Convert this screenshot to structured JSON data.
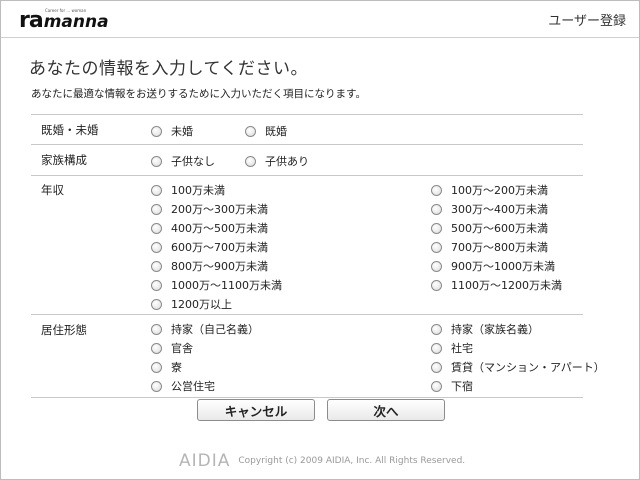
{
  "header": {
    "logo_main": "ra",
    "logo_sub": "manna",
    "logo_tagline": "Career for ... woman",
    "page_title": "ユーザー登録"
  },
  "main": {
    "heading": "あなたの情報を入力してください。",
    "subtext": "あなたに最適な情報をお送りするために入力いただく項目になります。"
  },
  "form": {
    "marital": {
      "label": "既婚・未婚",
      "options": [
        "未婚",
        "既婚"
      ]
    },
    "family": {
      "label": "家族構成",
      "options": [
        "子供なし",
        "子供あり"
      ]
    },
    "income": {
      "label": "年収",
      "left": [
        "100万未満",
        "200万～300万未満",
        "400万～500万未満",
        "600万～700万未満",
        "800万～900万未満",
        "1000万～1100万未満",
        "1200万以上"
      ],
      "right": [
        "100万～200万未満",
        "300万～400万未満",
        "500万～600万未満",
        "700万～800万未満",
        "900万～1000万未満",
        "1100万～1200万未満"
      ]
    },
    "residence": {
      "label": "居住形態",
      "left": [
        "持家（自己名義）",
        "官舎",
        "寮",
        "公営住宅"
      ],
      "right": [
        "持家（家族名義）",
        "社宅",
        "賃貸（マンション・アパート）",
        "下宿"
      ]
    }
  },
  "buttons": {
    "cancel": "キャンセル",
    "next": "次へ"
  },
  "footer": {
    "brand": "AIDIA",
    "copyright": "Copyright (c) 2009 AIDIA, Inc. All Rights Reserved."
  }
}
